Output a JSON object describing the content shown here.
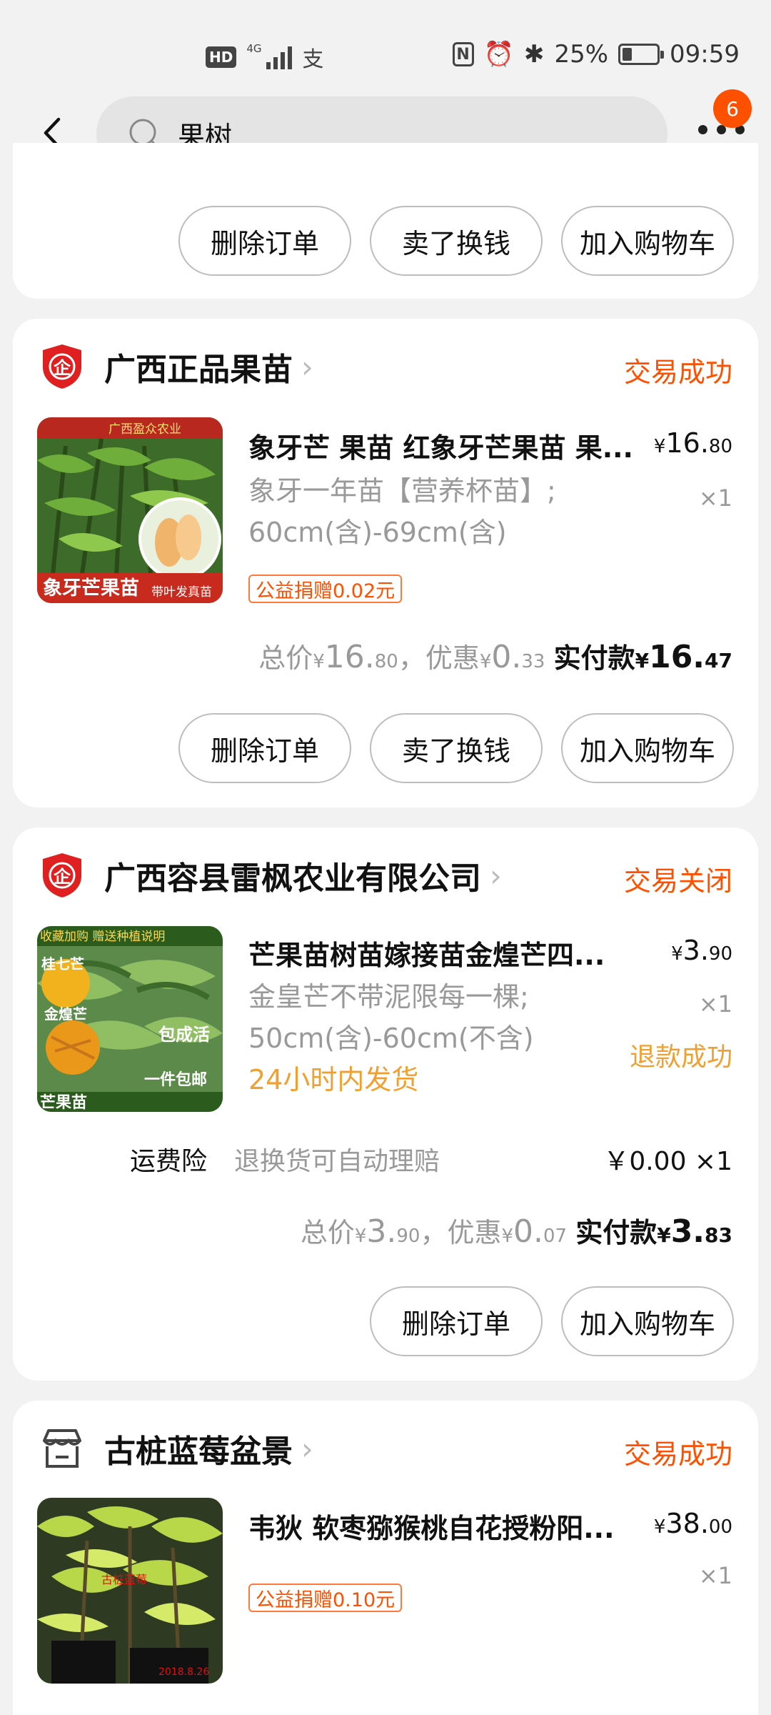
{
  "status_bar": {
    "hd": "HD",
    "network": "4G",
    "alipay_glyph": "支",
    "nfc": "N",
    "alarm": "⏰",
    "bluetooth": "✱",
    "battery": "25%",
    "battery_level": 0.25,
    "time": "09:59"
  },
  "header": {
    "search_text": "果树",
    "badge_count": "6"
  },
  "top_card": {
    "buttons": [
      "删除订单",
      "卖了换钱",
      "加入购物车"
    ]
  },
  "orders": [
    {
      "shop": "广西正品果苗",
      "status": "交易成功",
      "item": {
        "title": "象牙芒 果苗 红象牙芒果苗 果...",
        "sku_line1": "象牙一年苗【营养杯苗】;",
        "sku_line2": "60cm(含)-69cm(含)",
        "price_int": "16.",
        "price_dec": "80",
        "qty": "×1",
        "tag": "公益捐赠0.02元"
      },
      "summary": {
        "total_label": "总价",
        "total_int": "16.",
        "total_dec": "80",
        "discount_label": "，优惠",
        "discount_int": "0.",
        "discount_dec": "33",
        "paid_label": "实付款",
        "paid_int": "16.",
        "paid_dec": "47"
      },
      "buttons": [
        "删除订单",
        "卖了换钱",
        "加入购物车"
      ]
    },
    {
      "shop": "广西容县雷枫农业有限公司",
      "status": "交易关闭",
      "item": {
        "title": "芒果苗树苗嫁接苗金煌芒四...",
        "sku_line1": "金皇芒不带泥限每一棵;",
        "sku_line2": "50cm(含)-60cm(不含)",
        "ship": "24小时内发货",
        "refund": "退款成功",
        "price_int": "3.",
        "price_dec": "90",
        "qty": "×1"
      },
      "insurance": {
        "label": "运费险",
        "desc": "退换货可自动理赔",
        "price": "￥0.00 ×1"
      },
      "summary": {
        "total_label": "总价",
        "total_int": "3.",
        "total_dec": "90",
        "discount_label": "，优惠",
        "discount_int": "0.",
        "discount_dec": "07",
        "paid_label": "实付款",
        "paid_int": "3.",
        "paid_dec": "83"
      },
      "buttons": [
        "删除订单",
        "加入购物车"
      ]
    },
    {
      "shop": "古桩蓝莓盆景",
      "status": "交易成功",
      "item": {
        "title": "韦狄 软枣猕猴桃自花授粉阳...",
        "price_int": "38.",
        "price_dec": "00",
        "qty": "×1",
        "tag": "公益捐赠0.10元"
      }
    }
  ],
  "currency": "¥",
  "thumb_texts": {
    "mango1_top": "广西盈众农业",
    "mango1_bottom": "象牙芒果苗",
    "mango1_side": "带叶发真苗",
    "mango2_top": "收藏加购 赠送种植说明",
    "mango2_a": "桂七芒",
    "mango2_b": "金煌芒",
    "mango2_c": "包成活",
    "mango2_d": "一件包邮",
    "mango2_e": "芒果苗",
    "kiwi_a": "古桩蓝莓",
    "kiwi_b": "2018.8.26"
  },
  "colors": {
    "accent": "#ff5000",
    "refund": "#f0a030"
  }
}
